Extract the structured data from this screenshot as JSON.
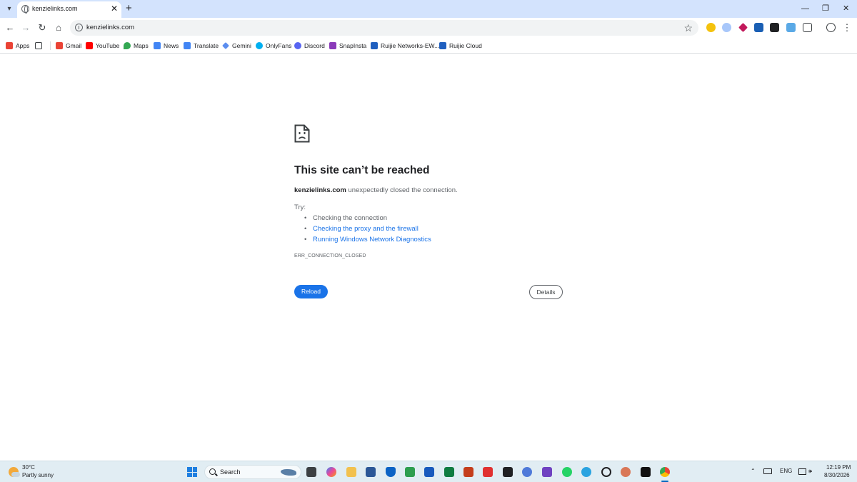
{
  "browser": {
    "tab": {
      "title": "kenzielinks.com",
      "close": "✕"
    },
    "new_tab": "+",
    "window_controls": {
      "minimize": "—",
      "restore": "❐",
      "close": "✕"
    },
    "nav": {
      "back": "←",
      "forward": "→",
      "reload": "↻",
      "home": "⌂"
    },
    "omnibox": {
      "url": "kenzielinks.com"
    },
    "star": "☆"
  },
  "bookmarks": {
    "apps_label": "Apps",
    "items": [
      {
        "label": "Gmail",
        "color": "#ea4335"
      },
      {
        "label": "YouTube",
        "color": "#ff0000"
      },
      {
        "label": "Maps",
        "color": "#34a853"
      },
      {
        "label": "News",
        "color": "#4285f4"
      },
      {
        "label": "Translate",
        "color": "#4285f4"
      },
      {
        "label": "Gemini",
        "color": "#5b8def"
      },
      {
        "label": "OnlyFans",
        "color": "#00aff0"
      },
      {
        "label": "Discord",
        "color": "#5865f2"
      },
      {
        "label": "SnapInsta",
        "color": "#8a3ab9"
      },
      {
        "label": "Ruijie Networks-EW...",
        "color": "#1f5fbf"
      },
      {
        "label": "Ruijie Cloud",
        "color": "#1f5fbf"
      }
    ]
  },
  "error": {
    "title": "This site can’t be reached",
    "host": "kenzielinks.com",
    "message": "unexpectedly closed the connection.",
    "try_label": "Try:",
    "suggestions": [
      {
        "text": "Checking the connection",
        "link": false
      },
      {
        "text": "Checking the proxy and the firewall",
        "link": true
      },
      {
        "text": "Running Windows Network Diagnostics",
        "link": true
      }
    ],
    "code": "ERR_CONNECTION_CLOSED",
    "reload_label": "Reload",
    "details_label": "Details"
  },
  "taskbar": {
    "weather": {
      "temp": "30°C",
      "condition": "Partly sunny"
    },
    "search_label": "Search",
    "tray": {
      "chevron": "⌃",
      "language": "ENG",
      "volume": "🕪"
    },
    "clock": {
      "time": "12:19 PM",
      "date": "8/30/2026"
    }
  },
  "colors": {
    "accent": "#1a73e8",
    "tabstrip": "#d3e3fd",
    "taskbar": "#e1edf3"
  }
}
